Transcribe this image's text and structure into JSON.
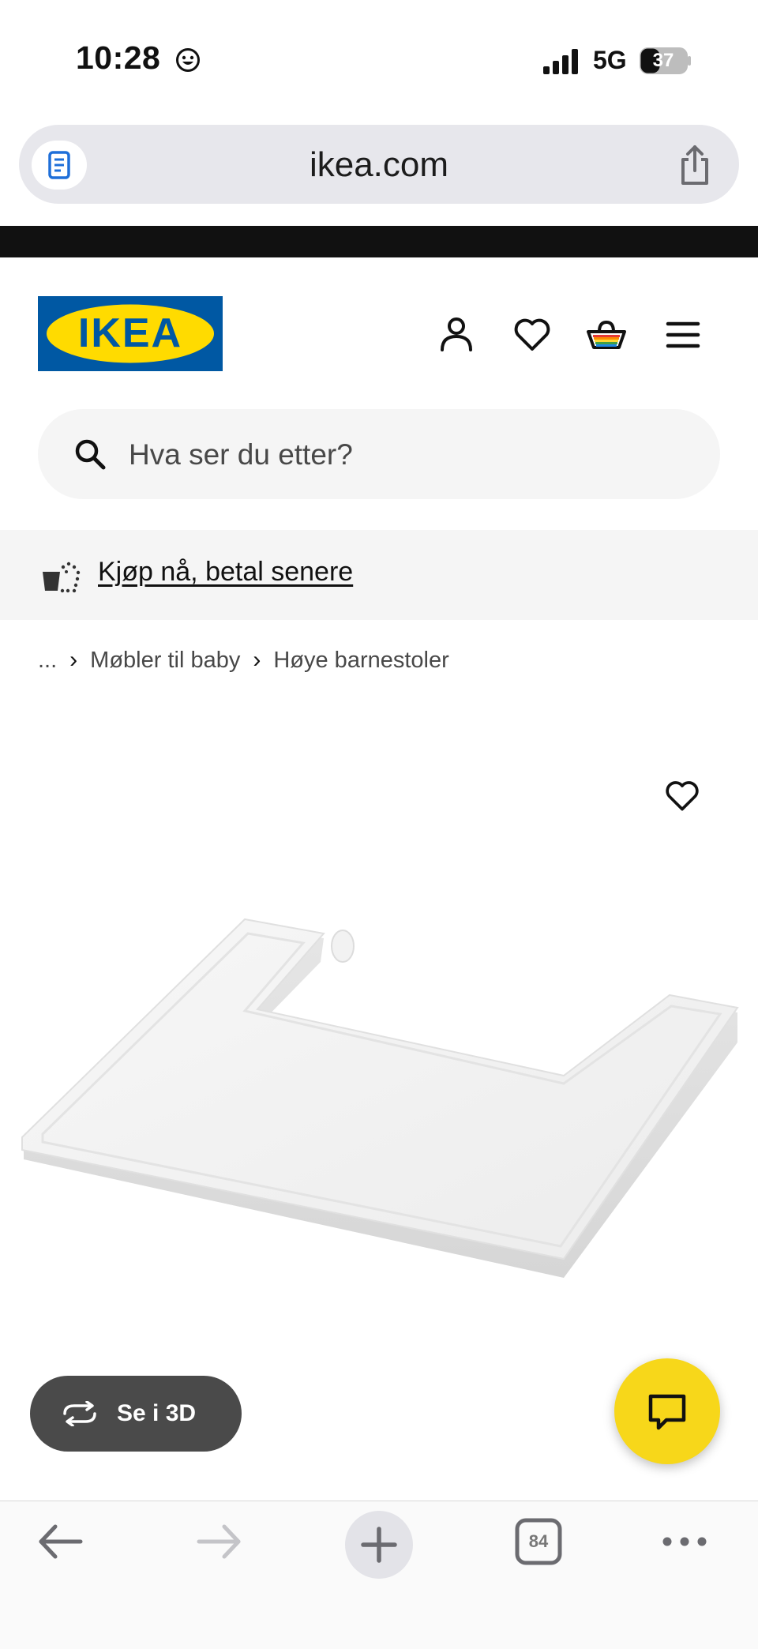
{
  "status_bar": {
    "time": "10:28",
    "network": "5G",
    "battery": "37"
  },
  "browser": {
    "url": "ikea.com",
    "tab_count": "84"
  },
  "header": {
    "logo_text": "IKEA"
  },
  "search": {
    "placeholder": "Hva ser du etter?"
  },
  "promo": {
    "text": "Kjøp nå, betal senere"
  },
  "breadcrumb": {
    "ellipsis": "...",
    "items": [
      "Møbler til baby",
      "Høye barnestoler"
    ]
  },
  "product": {
    "view_3d_label": "Se i 3D"
  },
  "colors": {
    "ikea_blue": "#0058a3",
    "ikea_yellow": "#ffdb00",
    "chat_yellow": "#f7d71a",
    "button_dark": "#4a4a4a"
  },
  "icons": [
    "smiley-icon",
    "signal-icon",
    "battery-icon",
    "reader-icon",
    "share-icon",
    "account-icon",
    "heart-icon",
    "cart-icon",
    "menu-icon",
    "search-icon",
    "installment-icon",
    "chevron-right-icon",
    "rotate-3d-icon",
    "chat-icon",
    "back-arrow-icon",
    "forward-arrow-icon",
    "new-tab-icon",
    "tabs-icon",
    "more-icon"
  ]
}
